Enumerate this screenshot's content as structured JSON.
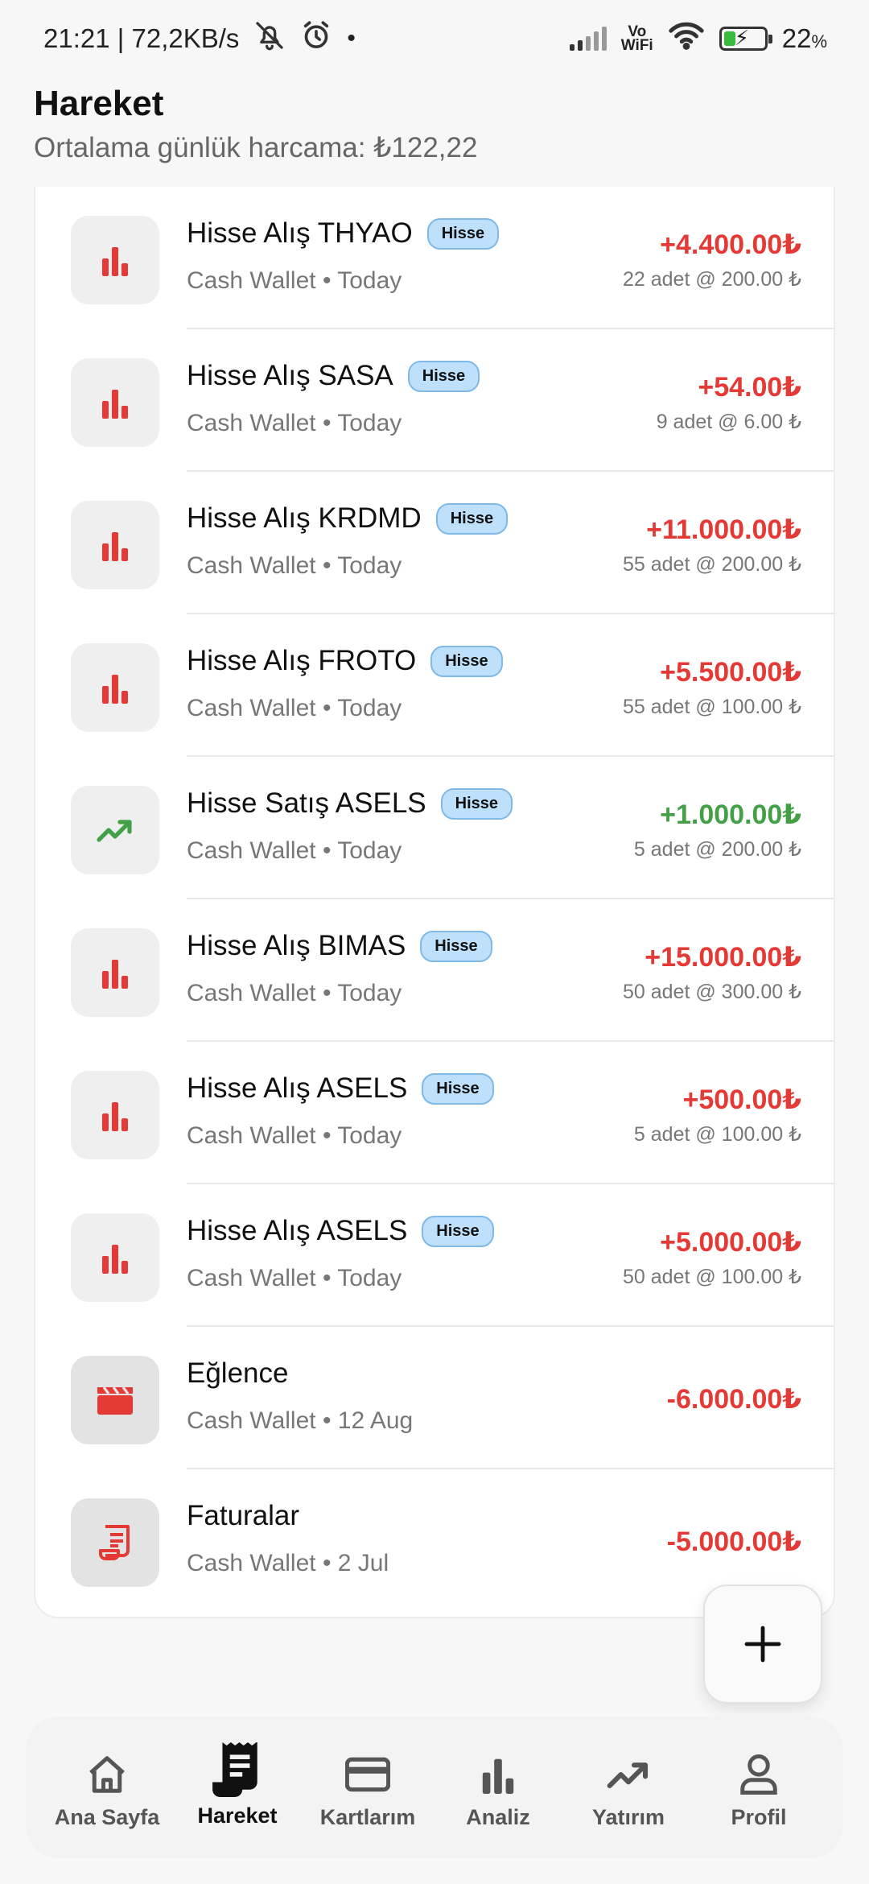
{
  "status_bar": {
    "time_speed": "21:21 | 72,2KB/s",
    "dot": "•",
    "volte_top": "Vo",
    "volte_bottom": "WiFi",
    "battery_percent": "22",
    "percent_sign": "%",
    "battery_level": 0.22,
    "icons": [
      "bell-off-icon",
      "alarm-icon",
      "signal-icon",
      "wifi-icon",
      "battery-charging-icon"
    ]
  },
  "header": {
    "title": "Hareket",
    "subtitle": "Ortalama günlük harcama: ₺122,22"
  },
  "transactions": [
    {
      "title": "Hisse Alış THYAO",
      "tag": "Hisse",
      "subtitle": "Cash Wallet • Today",
      "amount": "+4.400.00₺",
      "detail": "22 adet @ 200.00 ₺",
      "icon": "bar-chart-icon",
      "color": "#e53935"
    },
    {
      "title": "Hisse Alış SASA",
      "tag": "Hisse",
      "subtitle": "Cash Wallet • Today",
      "amount": "+54.00₺",
      "detail": "9 adet @ 6.00 ₺",
      "icon": "bar-chart-icon",
      "color": "#e53935"
    },
    {
      "title": "Hisse Alış KRDMD",
      "tag": "Hisse",
      "subtitle": "Cash Wallet • Today",
      "amount": "+11.000.00₺",
      "detail": "55 adet @ 200.00 ₺",
      "icon": "bar-chart-icon",
      "color": "#e53935"
    },
    {
      "title": "Hisse Alış FROTO",
      "tag": "Hisse",
      "subtitle": "Cash Wallet • Today",
      "amount": "+5.500.00₺",
      "detail": "55 adet @ 100.00 ₺",
      "icon": "bar-chart-icon",
      "color": "#e53935"
    },
    {
      "title": "Hisse Satış ASELS",
      "tag": "Hisse",
      "subtitle": "Cash Wallet • Today",
      "amount": "+1.000.00₺",
      "detail": "5 adet @ 200.00 ₺",
      "icon": "trending-up-icon",
      "color": "#43a047"
    },
    {
      "title": "Hisse Alış BIMAS",
      "tag": "Hisse",
      "subtitle": "Cash Wallet • Today",
      "amount": "+15.000.00₺",
      "detail": "50 adet @ 300.00 ₺",
      "icon": "bar-chart-icon",
      "color": "#e53935"
    },
    {
      "title": "Hisse Alış ASELS",
      "tag": "Hisse",
      "subtitle": "Cash Wallet • Today",
      "amount": "+500.00₺",
      "detail": "5 adet @ 100.00 ₺",
      "icon": "bar-chart-icon",
      "color": "#e53935"
    },
    {
      "title": "Hisse Alış ASELS",
      "tag": "Hisse",
      "subtitle": "Cash Wallet • Today",
      "amount": "+5.000.00₺",
      "detail": "50 adet @ 100.00 ₺",
      "icon": "bar-chart-icon",
      "color": "#e53935"
    },
    {
      "title": "Eğlence",
      "subtitle": "Cash Wallet • 12 Aug",
      "amount": "-6.000.00₺",
      "icon": "clapperboard-icon",
      "color": "#e53935"
    },
    {
      "title": "Faturalar",
      "subtitle": "Cash Wallet • 2 Jul",
      "amount": "-5.000.00₺",
      "icon": "receipt-icon",
      "color": "#e53935"
    }
  ],
  "fab": {
    "icon": "plus-icon"
  },
  "bottom_nav": {
    "active_index": 1,
    "items": [
      {
        "label": "Ana Sayfa",
        "icon": "home-icon"
      },
      {
        "label": "Hareket",
        "icon": "receipt-icon"
      },
      {
        "label": "Kartlarım",
        "icon": "credit-card-icon"
      },
      {
        "label": "Analiz",
        "icon": "bar-chart-icon"
      },
      {
        "label": "Yatırım",
        "icon": "trending-up-icon"
      },
      {
        "label": "Profil",
        "icon": "person-icon"
      }
    ]
  }
}
